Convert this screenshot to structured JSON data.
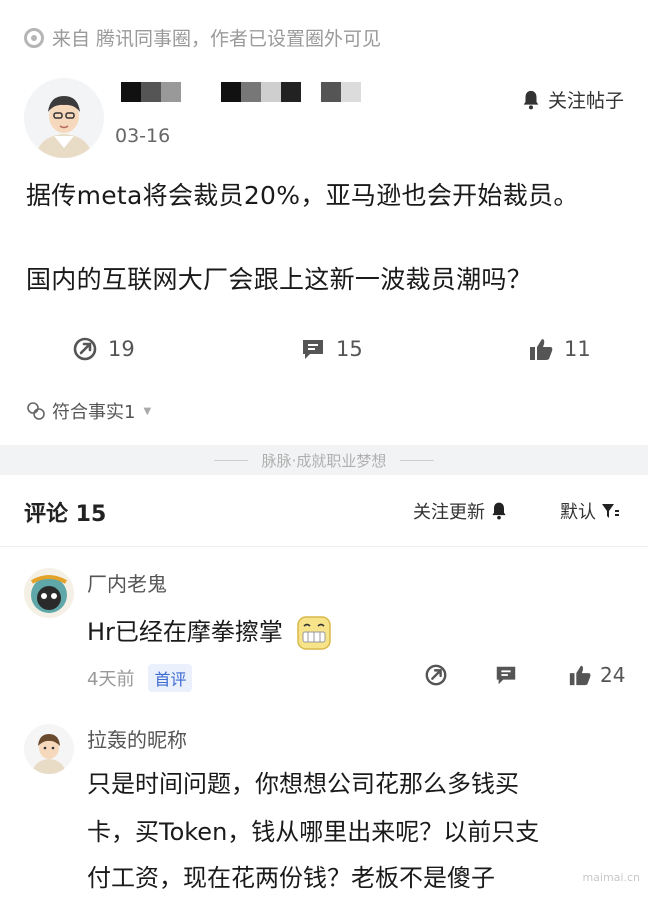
{
  "source": {
    "icon": "eye-circle-icon",
    "text": "来自 腾讯同事圈，作者已设置圈外可见"
  },
  "post": {
    "date": "03-16",
    "follow_label": "关注帖子",
    "lines": [
      "据传meta将会裁员20%，亚马逊也会开始裁员。",
      "国内的互联网大厂会跟上这新一波裁员潮吗？"
    ],
    "stats": {
      "share": "19",
      "comment": "15",
      "like": "11"
    },
    "fact_label": "符合事实1"
  },
  "divider": {
    "text": "脉脉·成就职业梦想"
  },
  "comments_header": {
    "title": "评论 15",
    "follow_updates": "关注更新",
    "sort": "默认"
  },
  "comments": [
    {
      "author": "厂内老鬼",
      "body": "Hr已经在摩拳擦掌",
      "time": "4天前",
      "badge": "首评",
      "likes": "24"
    },
    {
      "author": "拉轰的昵称",
      "body_lines": [
        "只是时间问题，你想想公司花那么多钱买",
        "卡，买Token，钱从哪里出来呢？以前只支",
        "付工资，现在花两份钱？老板不是傻子"
      ]
    }
  ],
  "watermark": "maimai.cn",
  "colors": {
    "accent_blue": "#3d6bd1",
    "divider_bg": "#f2f3f5",
    "muted_text": "#999999"
  }
}
